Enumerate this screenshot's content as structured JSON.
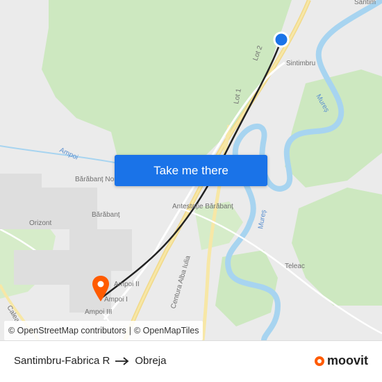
{
  "map": {
    "button_label": "Take me there",
    "places": [
      {
        "key": "santimbru_top",
        "label": "Sântim"
      },
      {
        "key": "santimbru",
        "label": "Sintimbru"
      },
      {
        "key": "lot2",
        "label": "Lot 2"
      },
      {
        "key": "lot1",
        "label": "Lot 1"
      },
      {
        "key": "mures1",
        "label": "Mureș"
      },
      {
        "key": "mures2",
        "label": "Mureș"
      },
      {
        "key": "ampoi",
        "label": "Ampoi"
      },
      {
        "key": "barabant_nord",
        "label": "Bărăbanț Nord"
      },
      {
        "key": "barabant",
        "label": "Bărăbanț"
      },
      {
        "key": "orizont",
        "label": "Orizont"
      },
      {
        "key": "antestatie",
        "label": "Antestație Bărăbanț"
      },
      {
        "key": "centura",
        "label": "Centura Alba Iulia"
      },
      {
        "key": "teleac",
        "label": "Teleac"
      },
      {
        "key": "ampoi2",
        "label": "Ampoi II"
      },
      {
        "key": "ampoi1",
        "label": "Ampoi I"
      },
      {
        "key": "ampoi3",
        "label": "Ampoi III"
      },
      {
        "key": "calea",
        "label": "Calea"
      }
    ],
    "attribution": {
      "osm": "© OpenStreetMap contributors",
      "separator": "|",
      "tiles": "© OpenMapTiles"
    },
    "colors": {
      "land": "#ebebeb",
      "forest": "#cde8c0",
      "water": "#a7d4f0",
      "road": "#f7e7a6",
      "route": "#222222",
      "origin": "#1a73e8",
      "destination": "#ff5b00"
    }
  },
  "footer": {
    "origin": "Santimbru-Fabrica R",
    "destination": "Obreja",
    "brand": "moovit"
  }
}
